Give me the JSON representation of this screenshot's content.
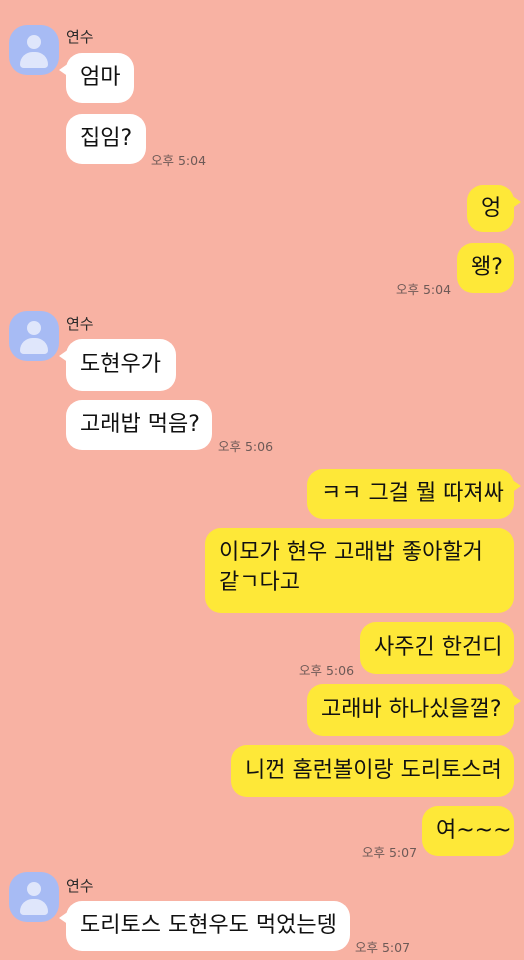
{
  "groups": [
    {
      "sender": "연수",
      "messages": [
        "엄마",
        "집임?"
      ],
      "time": "오후 5:04"
    },
    {
      "outgoing": true,
      "messages": [
        "엉",
        "왱?"
      ],
      "time": "오후 5:04"
    },
    {
      "sender": "연수",
      "messages": [
        "도현우가",
        "고래밥 먹음?"
      ],
      "time": "오후 5:06"
    },
    {
      "outgoing": true,
      "messages": [
        "ㅋㅋ 그걸 뭘 따져싸",
        "이모가 현우 고래밥 좋아할거같ㄱ다고",
        "사주긴 한건디"
      ],
      "time": "오후 5:06"
    },
    {
      "outgoing": true,
      "messages": [
        "고래바 하나싰을껄?",
        "니껀 홈런볼이랑 도리토스려",
        "여~~~"
      ],
      "time": "오후 5:07"
    },
    {
      "sender": "연수",
      "messages": [
        "도리토스 도현우도 먹었는뎅"
      ],
      "time": "오후 5:07"
    }
  ],
  "colors": {
    "background": "#f8b2a3",
    "incoming_bubble": "#ffffff",
    "outgoing_bubble": "#fee838",
    "avatar": "#a7bbf4"
  },
  "icons": {
    "avatar": "default-profile-icon"
  }
}
